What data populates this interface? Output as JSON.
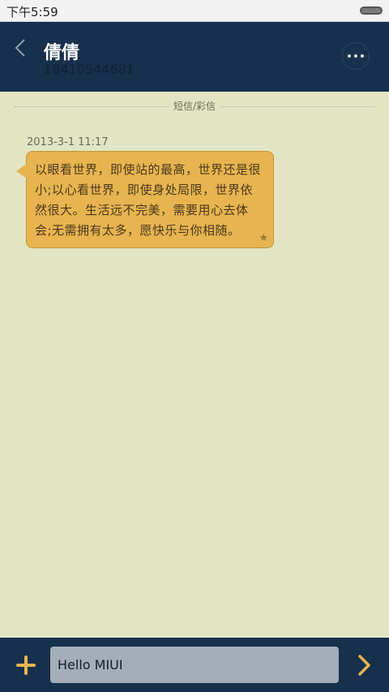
{
  "status_bar": {
    "time": "下午5:59"
  },
  "header": {
    "contact_name": "倩倩",
    "phone_number": "18410544681"
  },
  "conversation": {
    "type_label": "短信/彩信",
    "messages": [
      {
        "timestamp": "2013-3-1 11:17",
        "text": "以眼看世界，即使站的最高，世界还是很小;以心看世界，即使身处局限，世界依然很大。生活远不完美，需要用心去体会;无需拥有太多，愿快乐与你相随。",
        "starred": true
      }
    ]
  },
  "composer": {
    "input_value": "Hello MIUI"
  },
  "colors": {
    "header_bg": "#17304c",
    "chat_bg": "#e2e5c4",
    "bubble_bg": "#e7b450",
    "accent": "#e7b450"
  }
}
